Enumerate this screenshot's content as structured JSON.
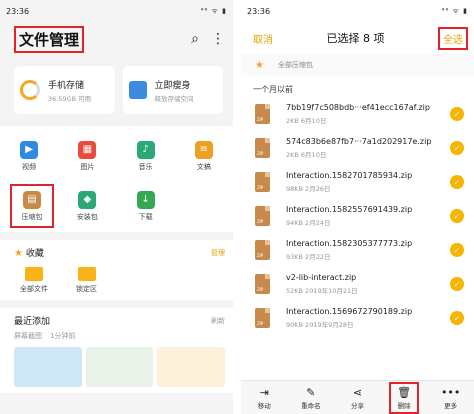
{
  "left": {
    "status_time": "23:36",
    "status_icons": "⁴⁶ ᯤ ▮",
    "title": "文件管理",
    "storage": {
      "title": "手机存储",
      "sub": "36.59GB 可用"
    },
    "clean": {
      "title": "立即瘦身",
      "sub": "释放存储空间"
    },
    "categories": [
      {
        "label": "视频",
        "color": "#2f8ae0",
        "icon": "video-icon",
        "glyph": "▶"
      },
      {
        "label": "图片",
        "color": "#e74c3c",
        "icon": "image-icon",
        "glyph": "▦"
      },
      {
        "label": "音乐",
        "color": "#2aa876",
        "icon": "music-icon",
        "glyph": "♪"
      },
      {
        "label": "文稿",
        "color": "#f0a020",
        "icon": "document-icon",
        "glyph": "≡"
      },
      {
        "label": "压缩包",
        "color": "#c98a48",
        "icon": "zip-icon",
        "glyph": "▤"
      },
      {
        "label": "安装包",
        "color": "#2aa876",
        "icon": "apk-icon",
        "glyph": "◆"
      },
      {
        "label": "下载",
        "color": "#34a853",
        "icon": "download-icon",
        "glyph": "↓"
      }
    ],
    "favorites": {
      "title": "收藏",
      "action": "管理",
      "items": [
        "全部文件",
        "锁定区"
      ]
    },
    "recent": {
      "title": "最近添加",
      "action": "刷新",
      "sub_source": "屏幕截图",
      "sub_time": "1分钟前"
    }
  },
  "right": {
    "status_time": "23:36",
    "status_icons": "⁴⁶ ᯤ ▮",
    "cancel": "取消",
    "title": "已选择 8 项",
    "select_all": "全选",
    "crumb": "全部压缩包",
    "group": "一个月以前",
    "zip_tag": "ZIP",
    "files": [
      {
        "name": "7bb19f7c508bdb···ef41ecc167af.zip",
        "meta": "2KB  6月10日"
      },
      {
        "name": "574c83b6e87fb7···7a1d202917e.zip",
        "meta": "2KB  6月10日"
      },
      {
        "name": "Interaction.1582701785934.zip",
        "meta": "98KB  2月26日"
      },
      {
        "name": "Interaction.1582557691439.zip",
        "meta": "94KB  2月24日"
      },
      {
        "name": "Interaction.1582305377773.zip",
        "meta": "93KB  2月22日"
      },
      {
        "name": "v2-lib-interact.zip",
        "meta": "52KB  2019年10月21日"
      },
      {
        "name": "Interaction.1569672790189.zip",
        "meta": "90KB  2019年9月28日"
      }
    ],
    "actions": [
      {
        "label": "移动",
        "icon": "move-icon",
        "glyph": "⇥"
      },
      {
        "label": "重命名",
        "icon": "rename-icon",
        "glyph": "✎"
      },
      {
        "label": "分享",
        "icon": "share-icon",
        "glyph": "⋖"
      },
      {
        "label": "删除",
        "icon": "delete-icon",
        "glyph": "🗑"
      },
      {
        "label": "更多",
        "icon": "more-icon",
        "glyph": "•••"
      }
    ]
  }
}
